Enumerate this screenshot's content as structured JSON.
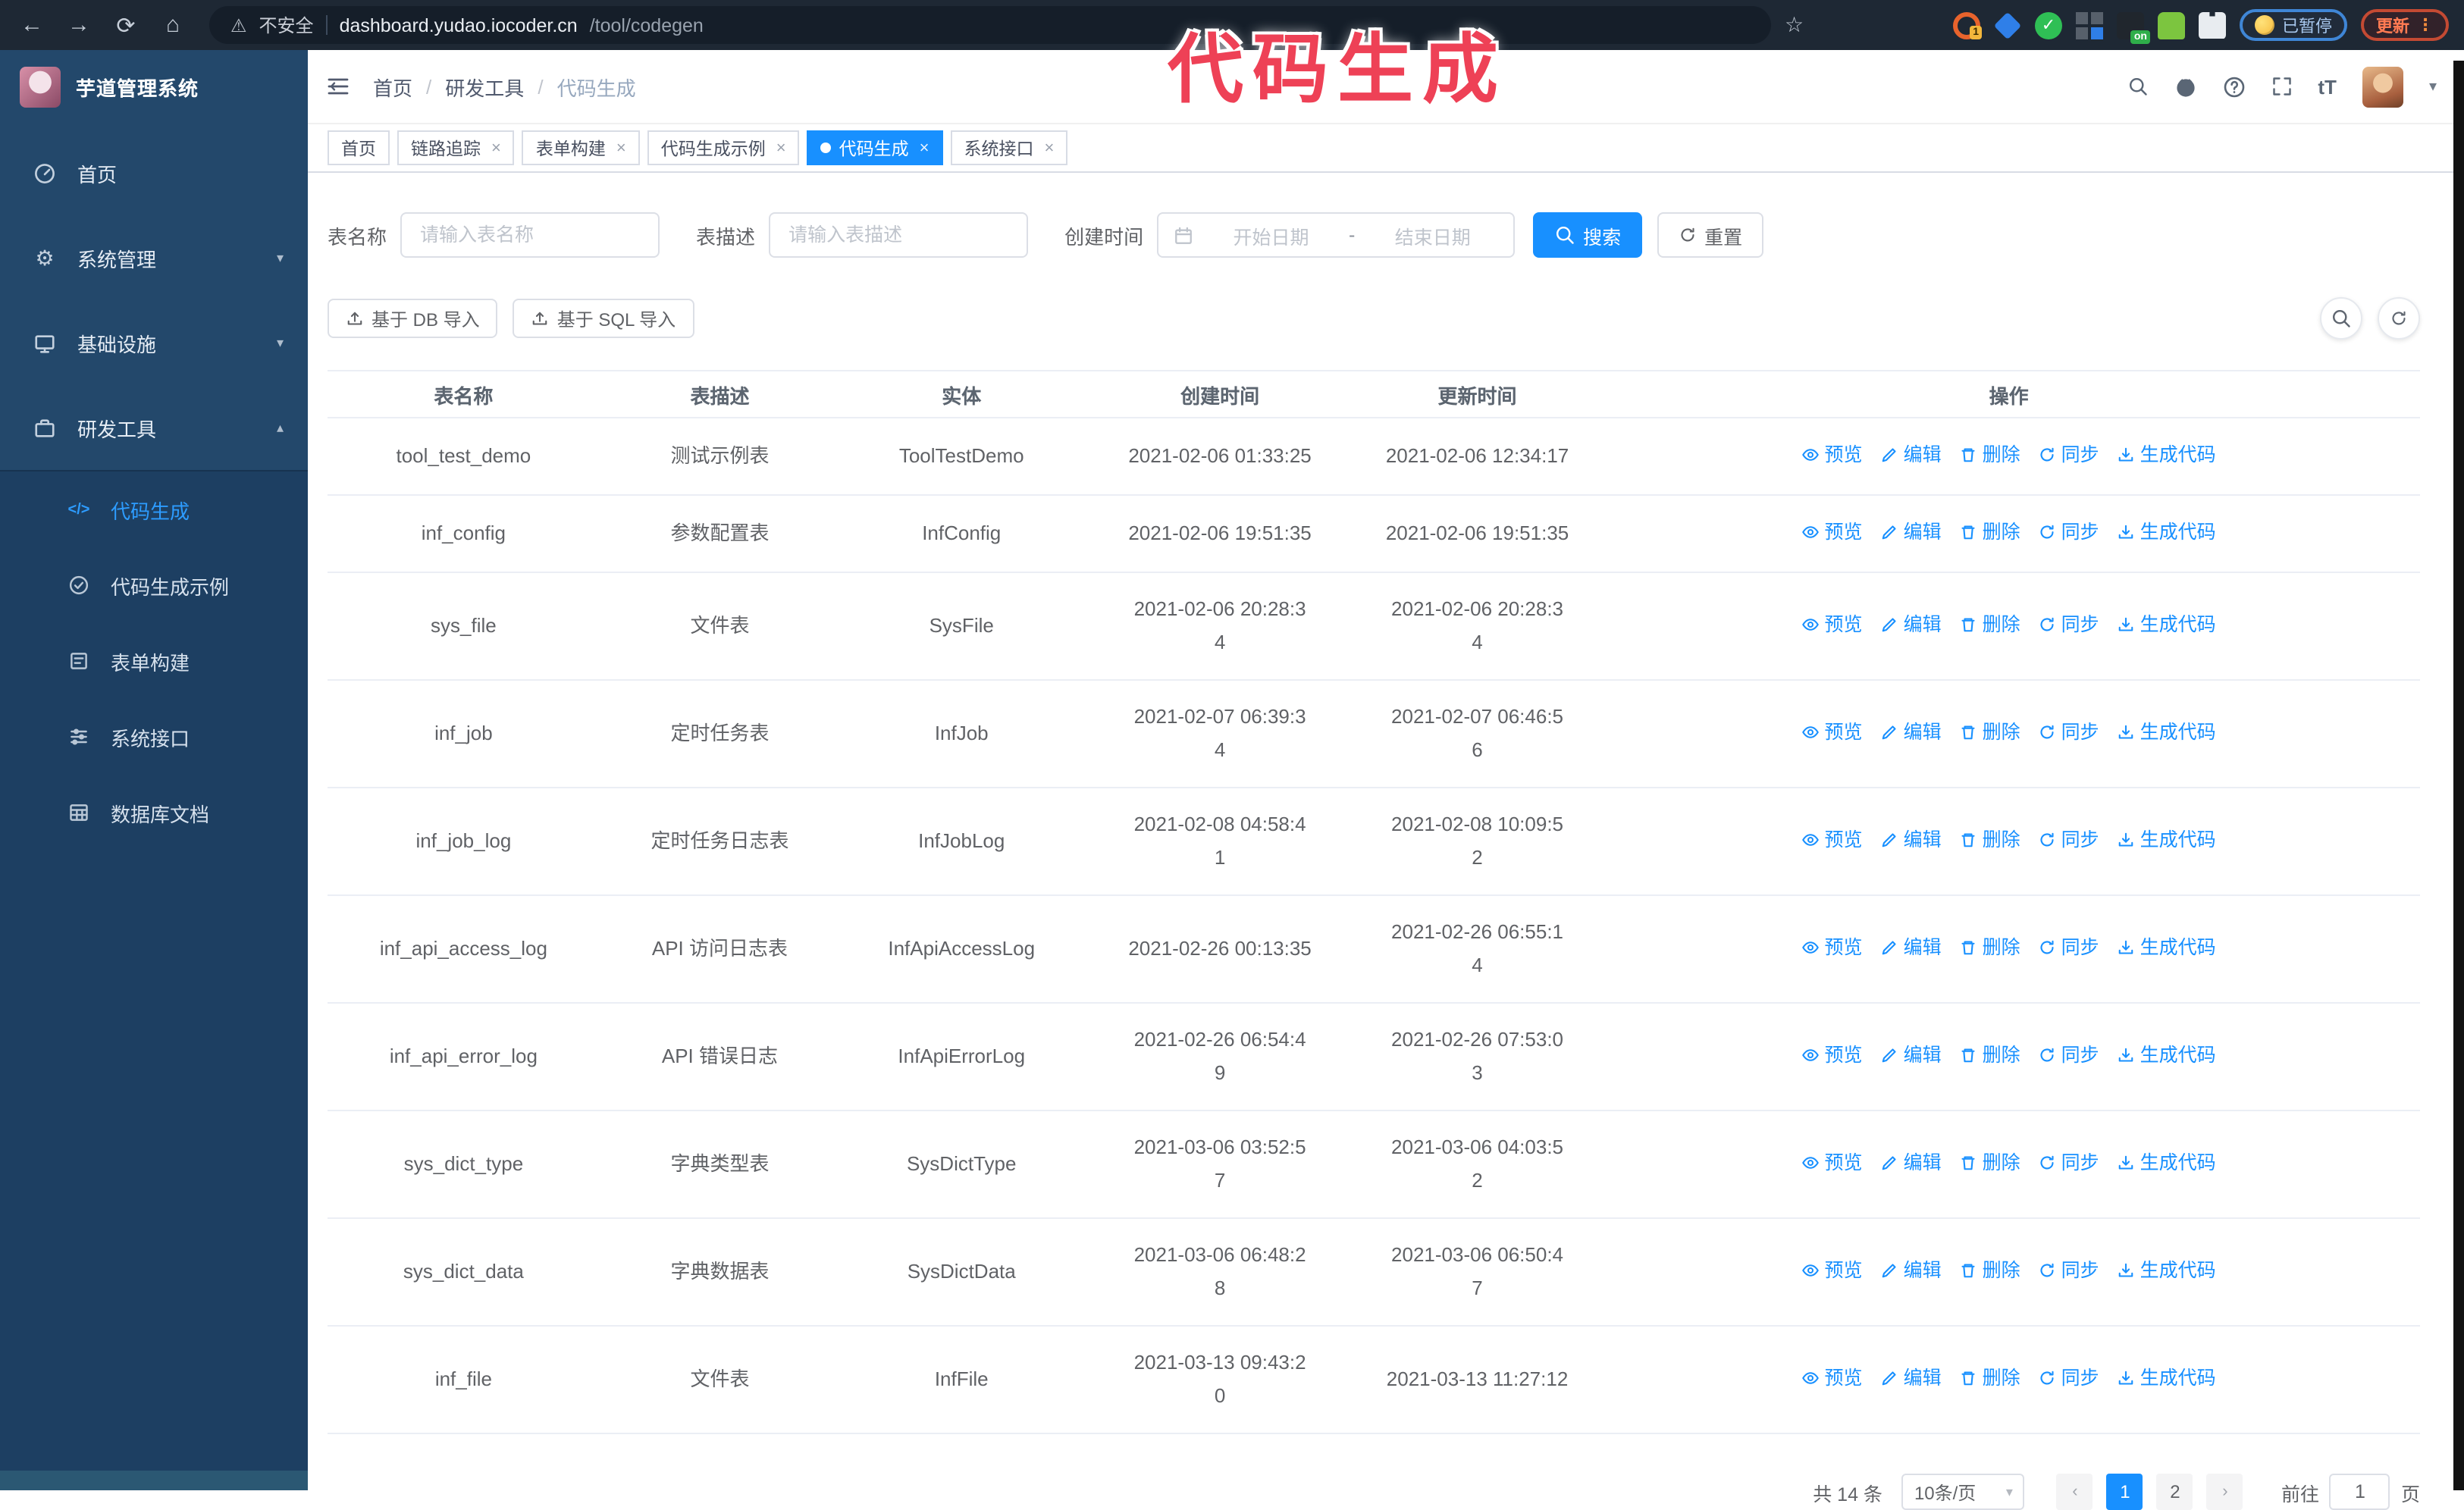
{
  "annotation": {
    "text": "代码生成",
    "color": "#ee4156"
  },
  "browser": {
    "nav_icons": [
      "back-icon",
      "forward-icon",
      "reload-icon",
      "home-icon"
    ],
    "security_label": "不安全",
    "url_host": "dashboard.yudao.iocoder.cn",
    "url_path": "/tool/codegen",
    "extensions": [
      {
        "icon": "circle-arrows-extension-icon",
        "badge": "1"
      },
      {
        "icon": "gem-extension-icon"
      },
      {
        "icon": "check-extension-icon"
      },
      {
        "icon": "grid-extension-icon"
      },
      {
        "icon": "dark-extension-icon",
        "badge": "on"
      },
      {
        "icon": "robot-extension-icon"
      },
      {
        "icon": "puzzle-extension-icon"
      }
    ],
    "paused_badge": "已暂停",
    "update_button": "更新",
    "update_dots": "⋮"
  },
  "sidebar": {
    "title": "芋道管理系统",
    "items": [
      {
        "label": "首页",
        "icon": "dashboard-icon",
        "chevron": ""
      },
      {
        "label": "系统管理",
        "icon": "gear-icon",
        "chevron": "down"
      },
      {
        "label": "基础设施",
        "icon": "infra-icon",
        "chevron": "down"
      },
      {
        "label": "研发工具",
        "icon": "tools-icon",
        "chevron": "up"
      }
    ],
    "submenu": [
      {
        "label": "代码生成",
        "icon": "code-icon",
        "active": true
      },
      {
        "label": "代码生成示例",
        "icon": "example-icon",
        "active": false
      },
      {
        "label": "表单构建",
        "icon": "form-icon",
        "active": false
      },
      {
        "label": "系统接口",
        "icon": "api-icon",
        "active": false
      },
      {
        "label": "数据库文档",
        "icon": "database-icon",
        "active": false
      }
    ]
  },
  "header": {
    "breadcrumb": [
      "首页",
      "研发工具",
      "代码生成"
    ],
    "separator": "/",
    "icons": [
      "search-icon",
      "github-icon",
      "question-icon",
      "fullscreen-icon",
      "fontsize-icon"
    ]
  },
  "tabs": [
    {
      "label": "首页",
      "closable": false,
      "active": false
    },
    {
      "label": "链路追踪",
      "closable": true,
      "active": false
    },
    {
      "label": "表单构建",
      "closable": true,
      "active": false
    },
    {
      "label": "代码生成示例",
      "closable": true,
      "active": false
    },
    {
      "label": "代码生成",
      "closable": true,
      "active": true
    },
    {
      "label": "系统接口",
      "closable": true,
      "active": false
    }
  ],
  "search": {
    "name_label": "表名称",
    "name_placeholder": "请输入表名称",
    "desc_label": "表描述",
    "desc_placeholder": "请输入表描述",
    "time_label": "创建时间",
    "start_placeholder": "开始日期",
    "range_separator": "-",
    "end_placeholder": "结束日期",
    "search_button": "搜索",
    "reset_button": "重置"
  },
  "toolbar": {
    "import_db_button": "基于 DB 导入",
    "import_sql_button": "基于 SQL 导入"
  },
  "table": {
    "columns": [
      "表名称",
      "表描述",
      "实体",
      "创建时间",
      "更新时间",
      "操作"
    ],
    "actions": [
      {
        "label": "预览",
        "icon": "eye-icon"
      },
      {
        "label": "编辑",
        "icon": "edit-icon"
      },
      {
        "label": "删除",
        "icon": "delete-icon"
      },
      {
        "label": "同步",
        "icon": "sync-icon"
      },
      {
        "label": "生成代码",
        "icon": "download-icon"
      }
    ],
    "rows": [
      {
        "name": "tool_test_demo",
        "desc": "测试示例表",
        "entity": "ToolTestDemo",
        "created": [
          "2021-02-06 01:33:25"
        ],
        "updated": [
          "2021-02-06 12:34:17"
        ]
      },
      {
        "name": "inf_config",
        "desc": "参数配置表",
        "entity": "InfConfig",
        "created": [
          "2021-02-06 19:51:35"
        ],
        "updated": [
          "2021-02-06 19:51:35"
        ]
      },
      {
        "name": "sys_file",
        "desc": "文件表",
        "entity": "SysFile",
        "created": [
          "2021-02-06 20:28:3",
          "4"
        ],
        "updated": [
          "2021-02-06 20:28:3",
          "4"
        ]
      },
      {
        "name": "inf_job",
        "desc": "定时任务表",
        "entity": "InfJob",
        "created": [
          "2021-02-07 06:39:3",
          "4"
        ],
        "updated": [
          "2021-02-07 06:46:5",
          "6"
        ]
      },
      {
        "name": "inf_job_log",
        "desc": "定时任务日志表",
        "entity": "InfJobLog",
        "created": [
          "2021-02-08 04:58:4",
          "1"
        ],
        "updated": [
          "2021-02-08 10:09:5",
          "2"
        ]
      },
      {
        "name": "inf_api_access_log",
        "desc": "API 访问日志表",
        "entity": "InfApiAccessLog",
        "created": [
          "2021-02-26 00:13:35"
        ],
        "updated": [
          "2021-02-26 06:55:1",
          "4"
        ]
      },
      {
        "name": "inf_api_error_log",
        "desc": "API 错误日志",
        "entity": "InfApiErrorLog",
        "created": [
          "2021-02-26 06:54:4",
          "9"
        ],
        "updated": [
          "2021-02-26 07:53:0",
          "3"
        ]
      },
      {
        "name": "sys_dict_type",
        "desc": "字典类型表",
        "entity": "SysDictType",
        "created": [
          "2021-03-06 03:52:5",
          "7"
        ],
        "updated": [
          "2021-03-06 04:03:5",
          "2"
        ]
      },
      {
        "name": "sys_dict_data",
        "desc": "字典数据表",
        "entity": "SysDictData",
        "created": [
          "2021-03-06 06:48:2",
          "8"
        ],
        "updated": [
          "2021-03-06 06:50:4",
          "7"
        ]
      },
      {
        "name": "inf_file",
        "desc": "文件表",
        "entity": "InfFile",
        "created": [
          "2021-03-13 09:43:2",
          "0"
        ],
        "updated": [
          "2021-03-13 11:27:12"
        ]
      }
    ]
  },
  "pagination": {
    "total": "共 14 条",
    "page_size": "10条/页",
    "pages": [
      "1",
      "2"
    ],
    "active_page": "1",
    "goto_label": "前往",
    "goto_value": "1",
    "page_suffix": "页"
  },
  "colors": {
    "accent": "#1890ff",
    "sidebar": "#23486b",
    "submenu": "#1d3f62",
    "chrome": "#1e2834",
    "annotation": "#ee4156"
  }
}
